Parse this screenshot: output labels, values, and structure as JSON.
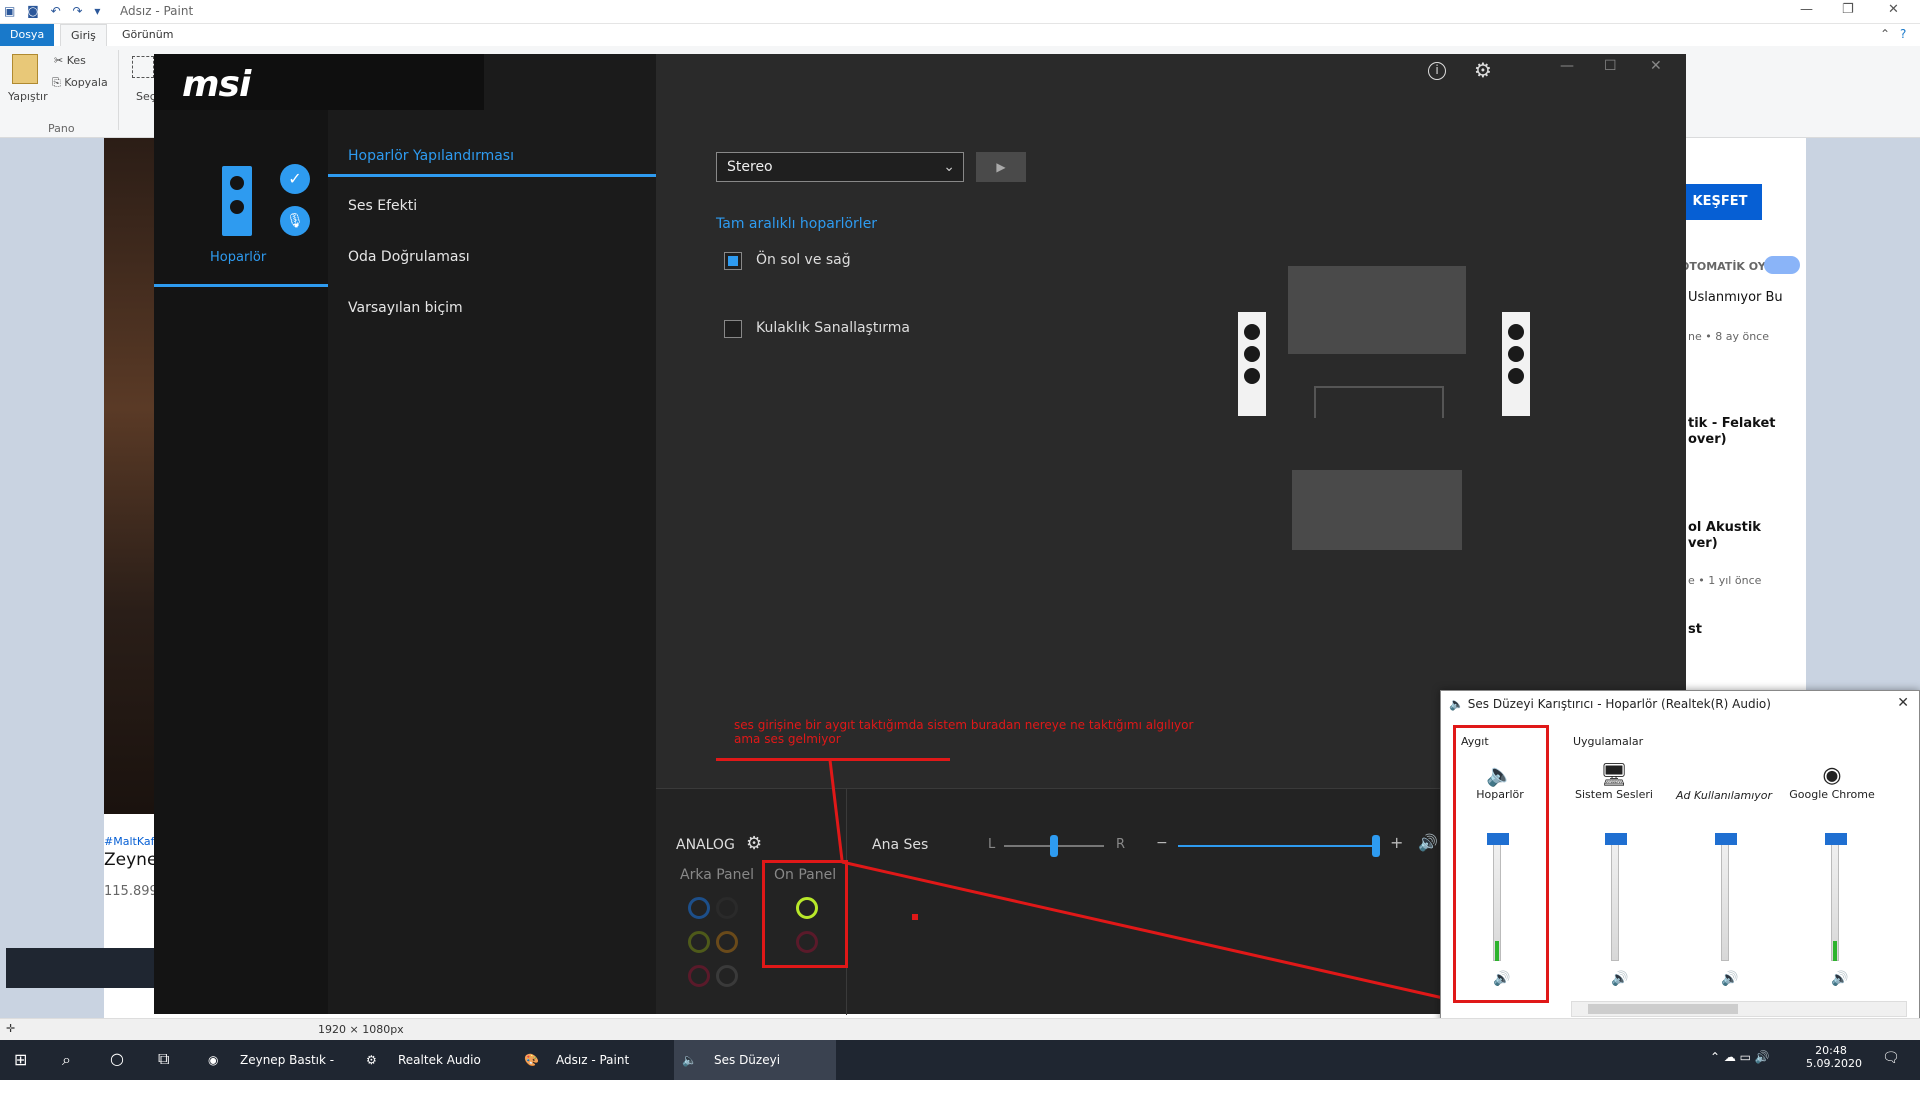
{
  "paint": {
    "title": "Adsız - Paint",
    "tabs": [
      "Dosya",
      "Giriş",
      "Görünüm"
    ],
    "clipboard": {
      "paste": "Yapıştır",
      "cut": "Kes",
      "copy": "Kopyala",
      "group": "Pano",
      "select": "Seç"
    },
    "status_size": "1920 × 1080px"
  },
  "youtube": {
    "explore": "KEŞFET",
    "autoplay": "OTOMATİK OYNAT",
    "items": [
      "Uslanmıyor Bu",
      "ne • 8 ay önce",
      "tik - Felaket",
      "over)",
      "ol Akustik",
      "ver)",
      "e • 1 yıl önce",
      "st"
    ],
    "hashtag": "#MaltKaf",
    "video_title": "Zeynep",
    "views": "115.899"
  },
  "msi": {
    "device_label": "Hoparlör",
    "menu": [
      "Hoparlör Yapılandırması",
      "Ses Efekti",
      "Oda Doğrulaması",
      "Varsayılan biçim"
    ],
    "config_select": "Stereo",
    "fullrange_title": "Tam aralıklı hoparlörler",
    "front_lr": "Ön sol ve sağ",
    "headphone_virt": "Kulaklık Sanallaştırma",
    "analog": "ANALOG",
    "rear_panel": "Arka Panel",
    "front_panel": "On Panel",
    "master": "Ana Ses",
    "left": "L",
    "right": "R",
    "minus": "−",
    "plus": "+"
  },
  "annotation": {
    "text_line1": "ses girişine bir aygıt taktığımda sistem buradan nereye ne taktığımı algılıyor",
    "text_line2": "ama ses gelmiyor"
  },
  "mixer": {
    "title": "Ses Düzeyi Karıştırıcı - Hoparlör (Realtek(R) Audio)",
    "device_section": "Aygıt",
    "apps_section": "Uygulamalar",
    "columns": [
      "Hoparlör",
      "Sistem Sesleri",
      "Ad Kullanılamıyor",
      "Google Chrome"
    ]
  },
  "taskbar": {
    "items": [
      "Zeynep Bastık - Fel...",
      "Realtek Audio Cons...",
      "Adsız - Paint",
      "Ses Düzeyi Karıştırıc..."
    ],
    "time": "20:48",
    "date": "5.09.2020"
  }
}
